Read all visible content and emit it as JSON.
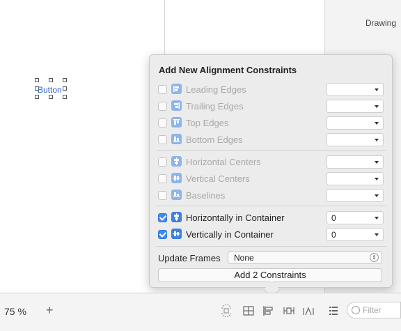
{
  "right_panel": {
    "title": "Drawing"
  },
  "canvas": {
    "button_label": "Button"
  },
  "popover": {
    "title": "Add New Alignment Constraints",
    "rows": [
      {
        "label": "Leading Edges",
        "checked": false,
        "enabled": false,
        "icon": "leading-edges-icon",
        "value": ""
      },
      {
        "label": "Trailing Edges",
        "checked": false,
        "enabled": false,
        "icon": "trailing-edges-icon",
        "value": ""
      },
      {
        "label": "Top Edges",
        "checked": false,
        "enabled": false,
        "icon": "top-edges-icon",
        "value": ""
      },
      {
        "label": "Bottom Edges",
        "checked": false,
        "enabled": false,
        "icon": "bottom-edges-icon",
        "value": ""
      },
      {
        "label": "Horizontal Centers",
        "checked": false,
        "enabled": false,
        "icon": "horizontal-centers-icon",
        "value": ""
      },
      {
        "label": "Vertical Centers",
        "checked": false,
        "enabled": false,
        "icon": "vertical-centers-icon",
        "value": ""
      },
      {
        "label": "Baselines",
        "checked": false,
        "enabled": false,
        "icon": "baselines-icon",
        "value": ""
      },
      {
        "label": "Horizontally in Container",
        "checked": true,
        "enabled": true,
        "icon": "horizontally-in-container-icon",
        "value": "0"
      },
      {
        "label": "Vertically in Container",
        "checked": true,
        "enabled": true,
        "icon": "vertically-in-container-icon",
        "value": "0"
      }
    ],
    "update_frames_label": "Update Frames",
    "update_frames_value": "None",
    "add_button_label": "Add 2 Constraints"
  },
  "bottom_bar": {
    "zoom": "75 %",
    "plus": "+",
    "filter_placeholder": "Filter",
    "icons": [
      "update-frames-icon",
      "embed-in-stack-icon",
      "align-icon",
      "pin-icon",
      "resolve-issues-icon",
      "document-outline-icon",
      "filter-icon"
    ]
  },
  "colors": {
    "accent": "#3d8bf5",
    "icon_blue": "#3e7fe0",
    "icon_dim": "#8fb4ec",
    "disabled_text": "#a8a8a8"
  }
}
